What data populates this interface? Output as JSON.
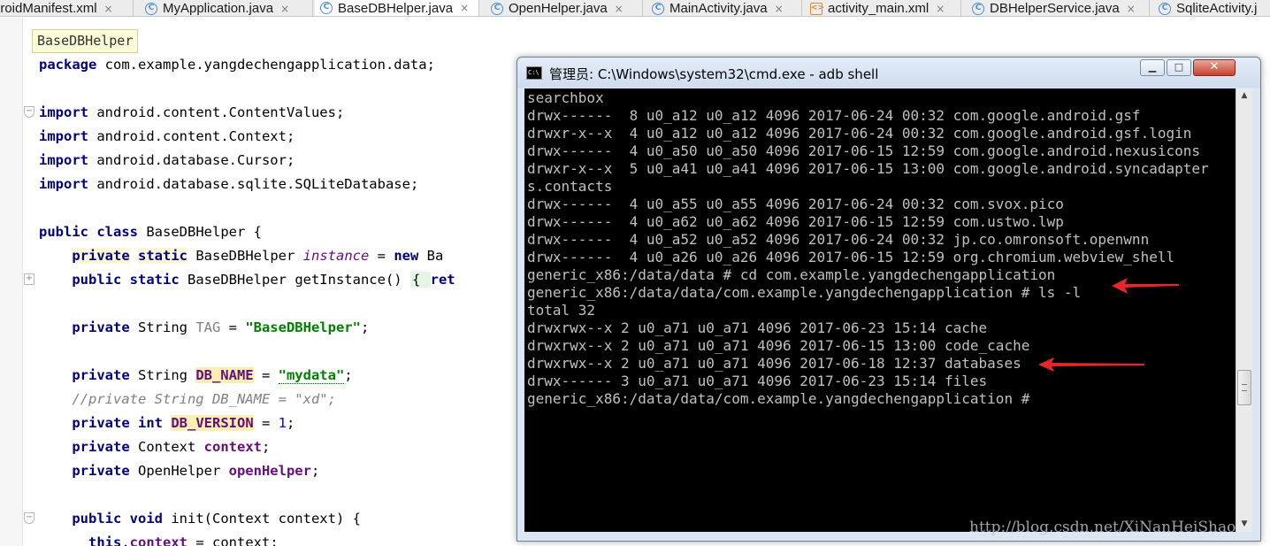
{
  "tabs": [
    {
      "label": "droidManifest.xml",
      "icon": "xml-file-icon",
      "active": false
    },
    {
      "label": "MyApplication.java",
      "icon": "java-class-icon",
      "active": false
    },
    {
      "label": "BaseDBHelper.java",
      "icon": "java-class-icon",
      "active": true
    },
    {
      "label": "OpenHelper.java",
      "icon": "java-class-icon",
      "active": false
    },
    {
      "label": "MainActivity.java",
      "icon": "java-class-icon",
      "active": false
    },
    {
      "label": "activity_main.xml",
      "icon": "xml-file-icon",
      "active": false
    },
    {
      "label": "DBHelperService.java",
      "icon": "java-class-icon",
      "active": false
    },
    {
      "label": "SqliteActivity.j",
      "icon": "java-class-icon",
      "active": false
    }
  ],
  "tab_close_glyph": "×",
  "editor": {
    "breadcrumb": "BaseDBHelper",
    "code": {
      "package_kw": "package",
      "package_name": " com.example.yangdechengapplication.data;",
      "imports": [
        "android.content.ContentValues;",
        "android.content.Context;",
        "android.database.Cursor;",
        "android.database.sqlite.SQLiteDatabase;"
      ],
      "import_kw": "import",
      "class_public": "public",
      "class_kw": "class",
      "class_rest": " BaseDBHelper {",
      "instance_line": {
        "private": "private",
        "static": "static",
        "type": " BaseDBHelper ",
        "name": "instance",
        "eq": " = ",
        "new": "new",
        "rest": " Ba"
      },
      "getinstance_line": {
        "public": "public",
        "static": "static",
        "rest": " BaseDBHelper getInstance() ",
        "fold": "{ ",
        "ret": "ret"
      },
      "tag_line": {
        "private": "private",
        "type": " String ",
        "name": "TAG",
        "eq": " = ",
        "value": "\"BaseDBHelper\"",
        "end": ";"
      },
      "dbname_line": {
        "private": "private",
        "type": " String ",
        "name": "DB_NAME",
        "eq": " = ",
        "value": "\"mydata\"",
        "end": ";"
      },
      "comment_line": "//private String DB_NAME = \"xd\";",
      "version_line": {
        "private": "private",
        "int": "int",
        "name": "DB_VERSION",
        "eq": " = ",
        "value": "1",
        "end": ";"
      },
      "context_line": {
        "private": "private",
        "type": " Context ",
        "name": "context",
        "end": ";"
      },
      "openhelper_line": {
        "private": "private",
        "type": " OpenHelper ",
        "name": "openHelper",
        "end": ";"
      },
      "init_line": {
        "public": "public",
        "void": "void",
        "rest": " init(Context context) {"
      },
      "this_line": {
        "this": "this",
        "dot": ".",
        "name": "context",
        "rest": " = context;"
      }
    }
  },
  "cmd": {
    "title": "管理员: C:\\Windows\\system32\\cmd.exe - adb  shell",
    "icon_text": "C:\\",
    "buttons": {
      "minimize": "▁",
      "maximize": "□",
      "close": "✕"
    },
    "lines": [
      "searchbox",
      "drwx------  8 u0_a12 u0_a12 4096 2017-06-24 00:32 com.google.android.gsf",
      "drwxr-x--x  4 u0_a12 u0_a12 4096 2017-06-24 00:32 com.google.android.gsf.login",
      "drwx------  4 u0_a50 u0_a50 4096 2017-06-15 12:59 com.google.android.nexusicons",
      "drwxr-x--x  5 u0_a41 u0_a41 4096 2017-06-15 13:00 com.google.android.syncadapter",
      "s.contacts",
      "drwx------  4 u0_a55 u0_a55 4096 2017-06-24 00:32 com.svox.pico",
      "drwx------  4 u0_a62 u0_a62 4096 2017-06-15 12:59 com.ustwo.lwp",
      "drwx------  4 u0_a52 u0_a52 4096 2017-06-24 00:32 jp.co.omronsoft.openwnn",
      "drwx------  4 u0_a26 u0_a26 4096 2017-06-15 12:59 org.chromium.webview_shell",
      "generic_x86:/data/data # cd com.example.yangdechengapplication",
      "generic_x86:/data/data/com.example.yangdechengapplication # ls -l",
      "total 32",
      "drwxrwx--x 2 u0_a71 u0_a71 4096 2017-06-23 15:14 cache",
      "drwxrwx--x 2 u0_a71 u0_a71 4096 2017-06-15 13:00 code_cache",
      "drwxrwx--x 2 u0_a71 u0_a71 4096 2017-06-18 12:37 databases",
      "drwx------ 3 u0_a71 u0_a71 4096 2017-06-23 15:14 files",
      "generic_x86:/data/data/com.example.yangdechengapplication #"
    ],
    "scroll": {
      "up": "▲",
      "down": "▼"
    }
  },
  "annotation_arrow_color": "#e8262a",
  "watermark": "http://blog.csdn.net/XiNanHeiShao"
}
